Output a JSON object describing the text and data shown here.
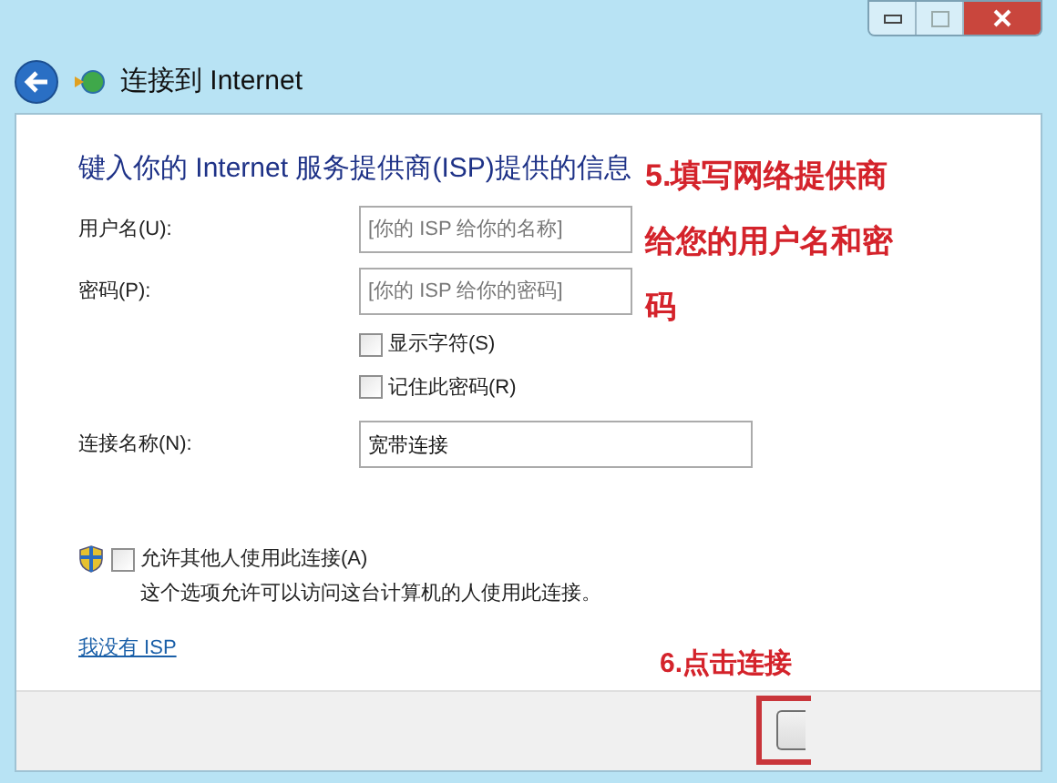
{
  "window": {
    "title": "连接到 Internet"
  },
  "heading": "键入你的 Internet 服务提供商(ISP)提供的信息",
  "fields": [
    {
      "label": "用户名(U):",
      "placeholder": "[你的 ISP 给你的名称]"
    },
    {
      "label": "密码(P):",
      "placeholder": "[你的 ISP 给你的密码]"
    }
  ],
  "options": [
    {
      "label": "显示字符(S)",
      "checked": false
    },
    {
      "label": "记住此密码(R)",
      "checked": false
    }
  ],
  "connection_name": {
    "label": "连接名称(N):",
    "value": "宽带连接"
  },
  "allow_others": {
    "label": "允许其他人使用此连接(A)",
    "checked": false,
    "description": "这个选项允许可以访问这台计算机的人使用此连接。"
  },
  "link": "我没有 ISP",
  "annotations": [
    {
      "lines": [
        "5.填写网络提供商",
        "给您的用户名和密",
        "码"
      ]
    },
    {
      "lines": [
        "6.点击连接"
      ]
    }
  ]
}
